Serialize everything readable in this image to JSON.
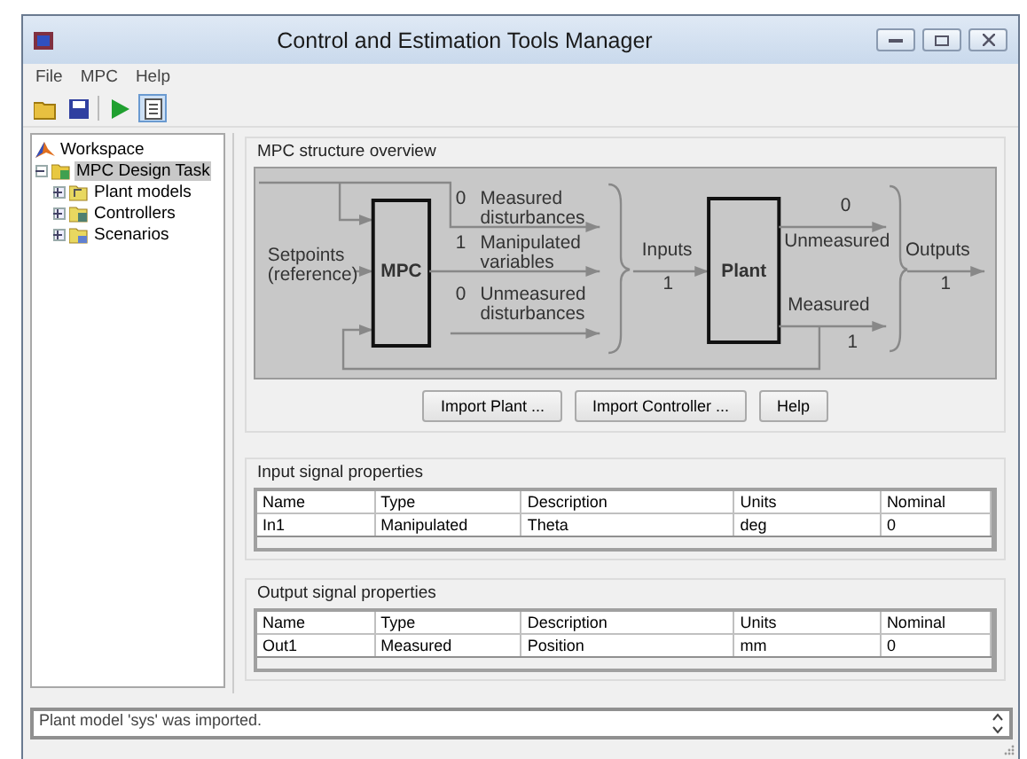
{
  "window": {
    "title": "Control and Estimation Tools Manager"
  },
  "menu": [
    "File",
    "MPC",
    "Help"
  ],
  "toolbar": [
    {
      "kind": "open",
      "pressed": false
    },
    {
      "kind": "save",
      "pressed": false
    },
    {
      "kind": "run",
      "pressed": false
    },
    {
      "kind": "log",
      "pressed": true
    }
  ],
  "tree": [
    {
      "label": "Workspace",
      "kind": "workspace",
      "selected": false,
      "children": [
        {
          "label": "MPC Design Task",
          "kind": "task",
          "selected": true,
          "expanded": true,
          "children": [
            {
              "label": "Plant models",
              "kind": "plant",
              "selected": false,
              "expanded": false
            },
            {
              "label": "Controllers",
              "kind": "controller",
              "selected": false,
              "expanded": false
            },
            {
              "label": "Scenarios",
              "kind": "scenario",
              "selected": false,
              "expanded": false
            }
          ]
        }
      ]
    }
  ],
  "overview": {
    "title": "MPC structure overview",
    "diagram": {
      "setpoints_lines": [
        "Setpoints",
        "(reference)"
      ],
      "controller": "MPC",
      "controller_outputs": [
        {
          "count": "0",
          "label_lines": [
            "Measured",
            "disturbances"
          ]
        },
        {
          "count": "1",
          "label_lines": [
            "Manipulated",
            "variables"
          ]
        },
        {
          "count": "0",
          "label_lines": [
            "Unmeasured",
            "disturbances"
          ]
        }
      ],
      "inputs_label": "Inputs",
      "inputs_count": "1",
      "plant": "Plant",
      "plant_outputs": [
        {
          "count": "0",
          "label": "Unmeasured"
        },
        {
          "count": "1",
          "label": "Measured"
        }
      ],
      "outputs_label": "Outputs",
      "outputs_count": "1"
    },
    "buttons": [
      "Import Plant ...",
      "Import Controller ...",
      "Help"
    ]
  },
  "input_signals": {
    "title": "Input signal properties",
    "columns": [
      "Name",
      "Type",
      "Description",
      "Units",
      "Nominal"
    ],
    "rows": [
      [
        "In1",
        "Manipulated",
        "Theta",
        "deg",
        "0"
      ]
    ]
  },
  "output_signals": {
    "title": "Output signal properties",
    "columns": [
      "Name",
      "Type",
      "Description",
      "Units",
      "Nominal"
    ],
    "rows": [
      [
        "Out1",
        "Measured",
        "Position",
        "mm",
        "0"
      ]
    ]
  },
  "status_log": "Plant model 'sys' was imported."
}
